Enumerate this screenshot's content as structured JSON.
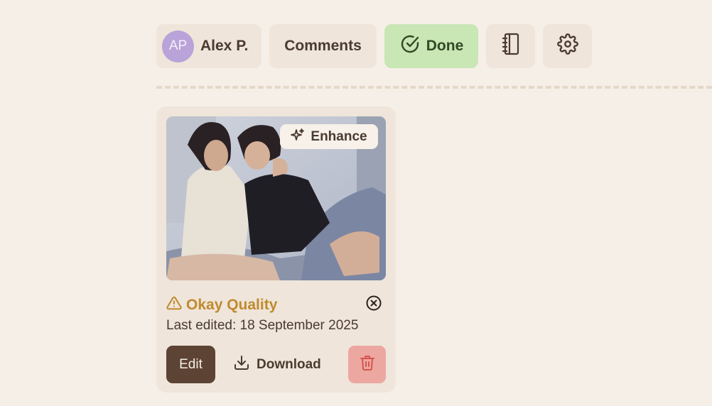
{
  "toolbar": {
    "user": {
      "initials": "AP",
      "name": "Alex P."
    },
    "comments_label": "Comments",
    "done_label": "Done",
    "notebook_icon": "notebook-icon",
    "settings_icon": "gear-icon"
  },
  "card": {
    "enhance_label": "Enhance",
    "quality_label": "Okay Quality",
    "last_edited": "Last edited: 18 September 2025",
    "edit_label": "Edit",
    "download_label": "Download"
  },
  "colors": {
    "background": "#f6efe7",
    "surface": "#efe5da",
    "done_bg": "#c9e6b5",
    "avatar_bg": "#b9a3d8",
    "warning": "#c08a2e",
    "edit_bg": "#5c4333",
    "delete_bg": "#eca7a1",
    "delete_icon": "#d9534f"
  }
}
